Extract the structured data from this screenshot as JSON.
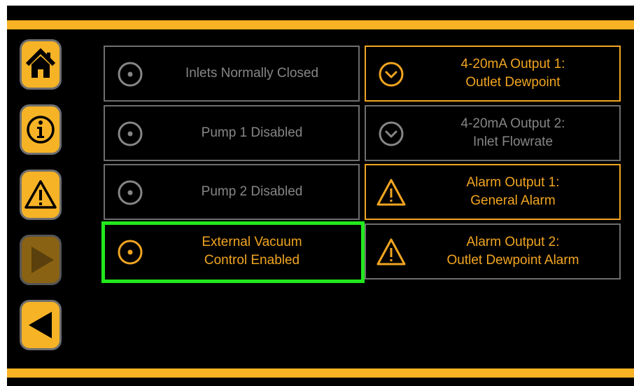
{
  "colors": {
    "accent": "#f9b224",
    "inactive": "#868686",
    "highlight": "#22e81d",
    "background": "#000000"
  },
  "nav": [
    {
      "name": "home-button",
      "icon": "home-icon",
      "state": "active"
    },
    {
      "name": "info-button",
      "icon": "info-icon",
      "state": "active"
    },
    {
      "name": "alarm-button",
      "icon": "warning-icon",
      "state": "active"
    },
    {
      "name": "play-button",
      "icon": "play-icon",
      "state": "disabled"
    },
    {
      "name": "back-button",
      "icon": "back-arrow-icon",
      "state": "active"
    }
  ],
  "inputs": [
    {
      "label": "Inlets Normally Closed",
      "state": "off",
      "icon": "radio-icon"
    },
    {
      "label": "Pump 1 Disabled",
      "state": "off",
      "icon": "radio-icon"
    },
    {
      "label": "Pump 2 Disabled",
      "state": "off",
      "icon": "radio-icon"
    },
    {
      "label": "External Vacuum\nControl Enabled",
      "state": "on",
      "icon": "radio-icon",
      "highlighted": true
    }
  ],
  "outputs": [
    {
      "label": "4-20mA Output 1:\nOutlet Dewpoint",
      "state": "on",
      "icon": "dropdown-chevron-icon"
    },
    {
      "label": "4-20mA Output 2:\nInlet Flowrate",
      "state": "off",
      "icon": "dropdown-chevron-icon"
    },
    {
      "label": "Alarm Output 1:\nGeneral Alarm",
      "state": "on",
      "icon": "warning-icon"
    },
    {
      "label": "Alarm Output 2:\nOutlet Dewpoint Alarm",
      "state": "off",
      "icon": "warning-icon"
    }
  ]
}
